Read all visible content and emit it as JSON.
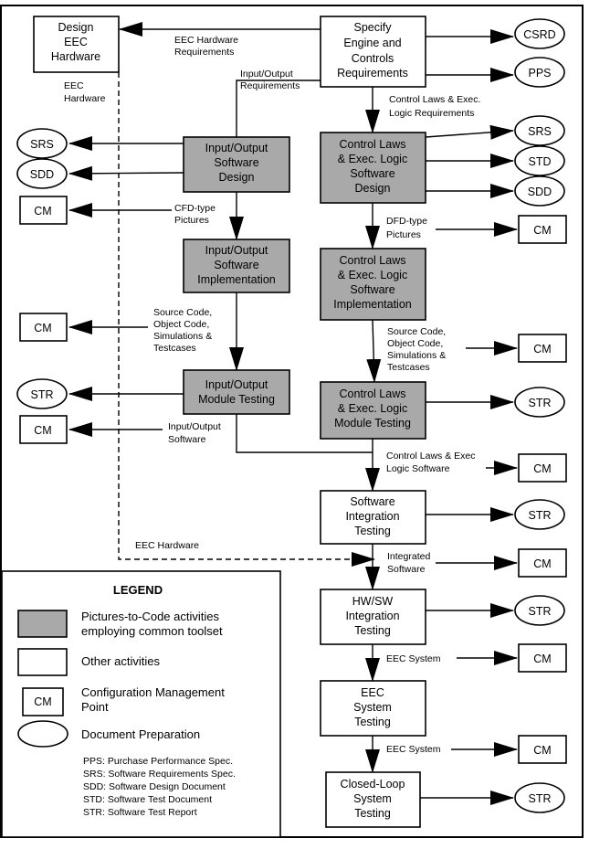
{
  "activities": {
    "design_eec": [
      "Design",
      "EEC",
      "Hardware"
    ],
    "specify": [
      "Specify",
      "Engine and",
      "Controls",
      "Requirements"
    ],
    "io_design": [
      "Input/Output",
      "Software",
      "Design"
    ],
    "cl_design": [
      "Control Laws",
      "& Exec. Logic",
      "Software",
      "Design"
    ],
    "io_impl": [
      "Input/Output",
      "Software",
      "Implementation"
    ],
    "cl_impl": [
      "Control Laws",
      "& Exec. Logic",
      "Software",
      "Implementation"
    ],
    "io_test": [
      "Input/Output",
      "Module Testing"
    ],
    "cl_test": [
      "Control Laws",
      "& Exec. Logic",
      "Module Testing"
    ],
    "sw_int": [
      "Software",
      "Integration",
      "Testing"
    ],
    "hwsw_int": [
      "HW/SW",
      "Integration",
      "Testing"
    ],
    "eec_sys": [
      "EEC",
      "System",
      "Testing"
    ],
    "closed_loop": [
      "Closed-Loop",
      "System",
      "Testing"
    ]
  },
  "docs": {
    "csrd": "CSRD",
    "pps": "PPS",
    "srs": "SRS",
    "sdd": "SDD",
    "std": "STD",
    "str": "STR",
    "cm": "CM"
  },
  "labels": {
    "eec_hw_req": [
      "EEC Hardware",
      "Requirements"
    ],
    "io_req": [
      "Input/Output",
      "Requirements"
    ],
    "eec_hw": [
      "EEC",
      "Hardware"
    ],
    "cl_req": [
      "Control Laws & Exec.",
      "Logic Requirements"
    ],
    "cfd": [
      "CFD-type",
      "Pictures"
    ],
    "dfd": [
      "DFD-type",
      "Pictures"
    ],
    "src_left": [
      "Source Code,",
      "Object Code,",
      "Simulations &",
      "Testcases"
    ],
    "src_right": [
      "Source Code,",
      "Object Code,",
      "Simulations &",
      "Testcases"
    ],
    "io_sw": [
      "Input/Output",
      "Software"
    ],
    "cl_sw": [
      "Control Laws & Exec",
      "Logic Software"
    ],
    "eec_hw_bottom": "EEC Hardware",
    "integrated": [
      "Integrated",
      "Software"
    ],
    "eec_system_1": "EEC System",
    "eec_system_2": "EEC System"
  },
  "legend": {
    "title": "LEGEND",
    "shaded": [
      "Pictures-to-Code activities",
      "employing common toolset"
    ],
    "other": "Other activities",
    "cm_box": "CM",
    "cm": [
      "Configuration Management",
      "Point"
    ],
    "doc": "Document Preparation",
    "abbrevs": [
      "PPS: Purchase Performance Spec.",
      "SRS: Software Requirements Spec.",
      "SDD: Software Design Document",
      "STD: Software Test Document",
      "STR: Software Test Report"
    ]
  },
  "colors": {
    "shaded_activity": "#a9a9a9",
    "line": "#000000"
  }
}
